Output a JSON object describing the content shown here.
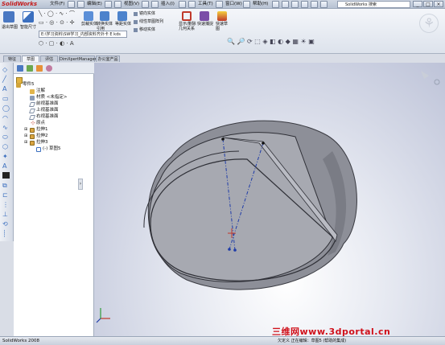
{
  "app": {
    "logo": "SolidWorks",
    "menus": [
      "文件(F)",
      "编辑(E)",
      "视图(V)",
      "插入(I)",
      "工具(T)",
      "窗口(W)",
      "帮助(H)"
    ],
    "search_placeholder": "SolidWorks 搜索",
    "window_controls": [
      "_",
      "□",
      "×"
    ]
  },
  "command_manager": {
    "path_value": "E:\\学习资料\\SW学习_内部资料齐外卡 E kds",
    "buttons": [
      {
        "label": "退出草图",
        "icon": "exit-sketch-icon",
        "color": "#4a78c2"
      },
      {
        "label": "智能尺寸",
        "icon": "smart-dimension-icon",
        "color": "#3b6fbf"
      },
      {
        "label": "剪裁实体",
        "icon": "trim-entities-icon",
        "color": "#5b8fd8"
      },
      {
        "label": "转换实体引用",
        "icon": "convert-entities-icon",
        "color": "#4c82cc"
      },
      {
        "label": "等距实体",
        "icon": "offset-entities-icon",
        "color": "#4c82cc"
      },
      {
        "label": "显示/删除几何关系",
        "icon": "relations-icon",
        "color": "#c0392b"
      },
      {
        "label": "快速捕捉",
        "icon": "quick-snaps-icon",
        "color": "#7a4ea8"
      },
      {
        "label": "快速草图",
        "icon": "rapid-sketch-icon",
        "color": "#c0392b"
      }
    ],
    "mirror": "镜向实体",
    "linear_pattern": "线性草图阵列",
    "move": "移动实体",
    "tabs": [
      "特征",
      "草图",
      "评估",
      "DimXpertManager",
      "办公室产品"
    ],
    "active_tab": 1
  },
  "feature_tree": {
    "root": "零件5",
    "nodes": [
      {
        "label": "注解",
        "icon": "annotations-icon",
        "indent": 1
      },
      {
        "label": "材质 <未指定>",
        "icon": "material-icon",
        "indent": 1
      },
      {
        "label": "前视基准面",
        "icon": "plane-icon",
        "indent": 1
      },
      {
        "label": "上视基准面",
        "icon": "plane-icon",
        "indent": 1
      },
      {
        "label": "右视基准面",
        "icon": "plane-icon",
        "indent": 1
      },
      {
        "label": "原点",
        "icon": "origin-icon",
        "indent": 1
      },
      {
        "label": "拉伸1",
        "icon": "extrude-icon",
        "indent": 1
      },
      {
        "label": "拉伸2",
        "icon": "extrude-icon",
        "indent": 1
      },
      {
        "label": "拉伸3",
        "icon": "extrude-icon",
        "indent": 1
      },
      {
        "label": "(-) 草图5",
        "icon": "sketch-icon",
        "indent": 2
      }
    ]
  },
  "status": {
    "left": "SolidWorks 2008",
    "mid": "欠定义    正在编辑：草图5    (帮助的集成)"
  },
  "watermark": "三维网www.3dportal.cn",
  "colors": {
    "accent": "#4a78c2",
    "model_face": "#8d8f98",
    "model_inner": "#a7a9b1",
    "sketch_line": "#1f3ca8",
    "watermark": "#d0101a"
  }
}
